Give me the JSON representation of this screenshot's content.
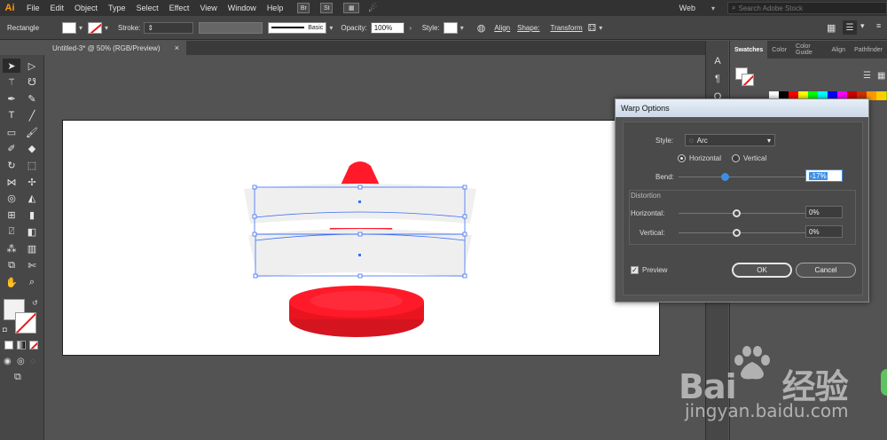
{
  "app": {
    "logo_text": "Ai"
  },
  "menu": {
    "items": [
      "File",
      "Edit",
      "Object",
      "Type",
      "Select",
      "Effect",
      "View",
      "Window",
      "Help"
    ],
    "bridge_badge": "Br",
    "stock_badge": "St"
  },
  "workspace": {
    "label": "Web"
  },
  "search": {
    "placeholder": "Search Adobe Stock"
  },
  "control_bar": {
    "object_type": "Rectangle",
    "stroke_label": "Stroke:",
    "stroke_profile": "Basic",
    "opacity_label": "Opacity:",
    "opacity_value": "100%",
    "style_label": "Style:",
    "align_label": "Align",
    "shape_label": "Shape:",
    "transform_label": "Transform"
  },
  "document_tab": {
    "title": "Untitled-3* @ 50% (RGB/Preview)",
    "close": "×"
  },
  "panel": {
    "tabs": [
      "Swatches",
      "Color",
      "Color Guide",
      "Align",
      "Pathfinder"
    ],
    "active_tab": "Swatches",
    "swatch_colors": [
      "#ffffff",
      "#000000",
      "#ff0000",
      "#ffff00",
      "#00ff00",
      "#00ffff",
      "#0000ff",
      "#ff00ff",
      "#cc0000",
      "#cc3300",
      "#ff9900",
      "#ffcc00",
      "#99cc00"
    ]
  },
  "warp_dialog": {
    "title": "Warp Options",
    "style_label": "Style:",
    "style_value": "Arc",
    "orientation": {
      "horizontal": "Horizontal",
      "vertical": "Vertical",
      "selected": "Horizontal"
    },
    "bend_label": "Bend:",
    "bend_value": "-17%",
    "distortion_label": "Distortion",
    "dist_horizontal_label": "Horizontal:",
    "dist_horizontal_value": "0%",
    "dist_vertical_label": "Vertical:",
    "dist_vertical_value": "0%",
    "preview_label": "Preview",
    "preview_checked": true,
    "ok_label": "OK",
    "cancel_label": "Cancel"
  },
  "watermark": {
    "logo": "Bai",
    "logo_cn": "经验",
    "url": "jingyan.baidu.com"
  },
  "colors": {
    "cone_red": "#ff1a2a",
    "cone_dark": "#d4141f",
    "stripe_gray": "#efefef",
    "selection_blue": "#3b6ef5",
    "accent_blue": "#3d8ee6"
  }
}
